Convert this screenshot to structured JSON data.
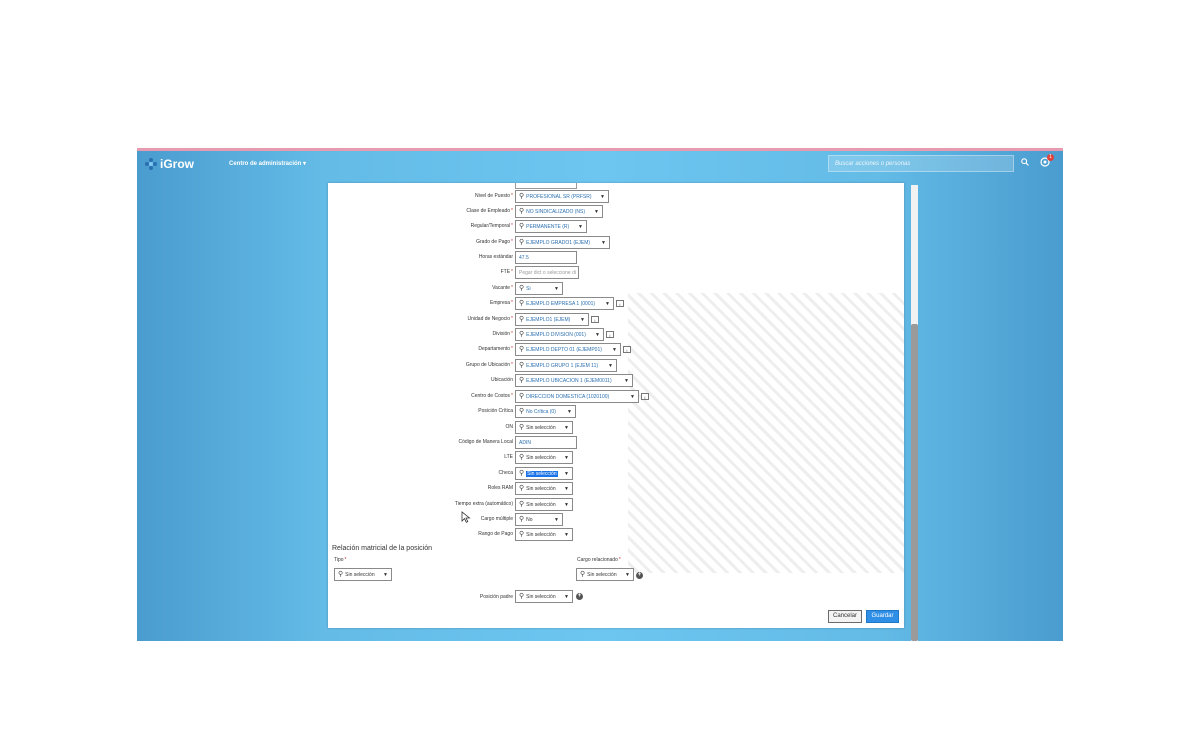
{
  "app": {
    "logo_text": "iGrow",
    "admin_menu": "Centro de administración",
    "search_placeholder": "Buscar acciones o personas",
    "notification_count": "1"
  },
  "form": {
    "fields": [
      {
        "label": "Nivel de Puesto",
        "required": true,
        "value": "PROFESIONAL SR (PRFSR)",
        "type": "select"
      },
      {
        "label": "Clase de Empleado",
        "required": true,
        "value": "NO SINDICALIZADO (NS)",
        "type": "select"
      },
      {
        "label": "Regular/Temporal",
        "required": true,
        "value": "PERMANENTE (R)",
        "type": "select"
      },
      {
        "label": "Grado de Pago",
        "required": true,
        "value": "EJEMPLO GRADO1 (EJEM)",
        "type": "select"
      },
      {
        "label": "Horas estándar",
        "required": false,
        "value": "47.5",
        "type": "text"
      },
      {
        "label": "FTE",
        "required": true,
        "value": "Pegar dict o seleccione di",
        "type": "text",
        "placeholder": true
      },
      {
        "label": "Vacante",
        "required": true,
        "value": "Si",
        "type": "select"
      },
      {
        "label": "Empresa",
        "required": true,
        "value": "EJEMPLO EMPRESA 1 (0001)",
        "type": "select",
        "info": true
      },
      {
        "label": "Unidad de Negocio",
        "required": true,
        "value": "EJEMPLO1 (EJEM)",
        "type": "select",
        "info": true
      },
      {
        "label": "División",
        "required": true,
        "value": "EJEMPLO DIVISION (001)",
        "type": "select",
        "info": true
      },
      {
        "label": "Departamento",
        "required": true,
        "value": "EJEMPLO DEPTO 01 (EJEMP01)",
        "type": "select",
        "info": true
      },
      {
        "label": "Grupo de Ubicación",
        "required": true,
        "value": "EJEMPLO GRUPO 1 (EJEM 11)",
        "type": "select"
      },
      {
        "label": "Ubicación",
        "required": false,
        "value": "EJEMPLO UBICACION 1 (EJEM0011)",
        "type": "select"
      },
      {
        "label": "Centro de Costos",
        "required": true,
        "value": "DIRECCION DOMESTICA (1020100)",
        "type": "select",
        "info": true
      },
      {
        "label": "Posición Crítica",
        "required": false,
        "value": "No Crítica (0)",
        "type": "select"
      },
      {
        "label": "ON",
        "required": false,
        "value": "Sin selección",
        "type": "select",
        "plain": true
      },
      {
        "label": "Código de Manera Local",
        "required": false,
        "value": "ADIN",
        "type": "text"
      },
      {
        "label": "LTE",
        "required": false,
        "value": "Sin selección",
        "type": "select",
        "plain": true
      },
      {
        "label": "Checa",
        "required": false,
        "value": "Sin selección",
        "type": "select",
        "highlight": true
      },
      {
        "label": "Roles RAM",
        "required": false,
        "value": "Sin selección",
        "type": "select",
        "plain": true
      },
      {
        "label": "Tiempo extra (automático)",
        "required": false,
        "value": "Sin selección",
        "type": "select",
        "plain": true
      },
      {
        "label": "Cargo múltiple",
        "required": false,
        "value": "No",
        "type": "select",
        "plain": true
      },
      {
        "label": "Rango de Pago",
        "required": false,
        "value": "Sin selección",
        "type": "select",
        "plain": true
      }
    ],
    "matrix": {
      "title": "Relación matricial de la posición",
      "tipo_label": "Tipo",
      "tipo_value": "Sin selección",
      "cargo_label": "Cargo relacionado",
      "cargo_value": "Sin selección"
    },
    "posicion_padre": {
      "label": "Posición padre",
      "value": "Sin selección"
    },
    "buttons": {
      "cancel": "Cancelar",
      "save": "Guardar"
    }
  }
}
